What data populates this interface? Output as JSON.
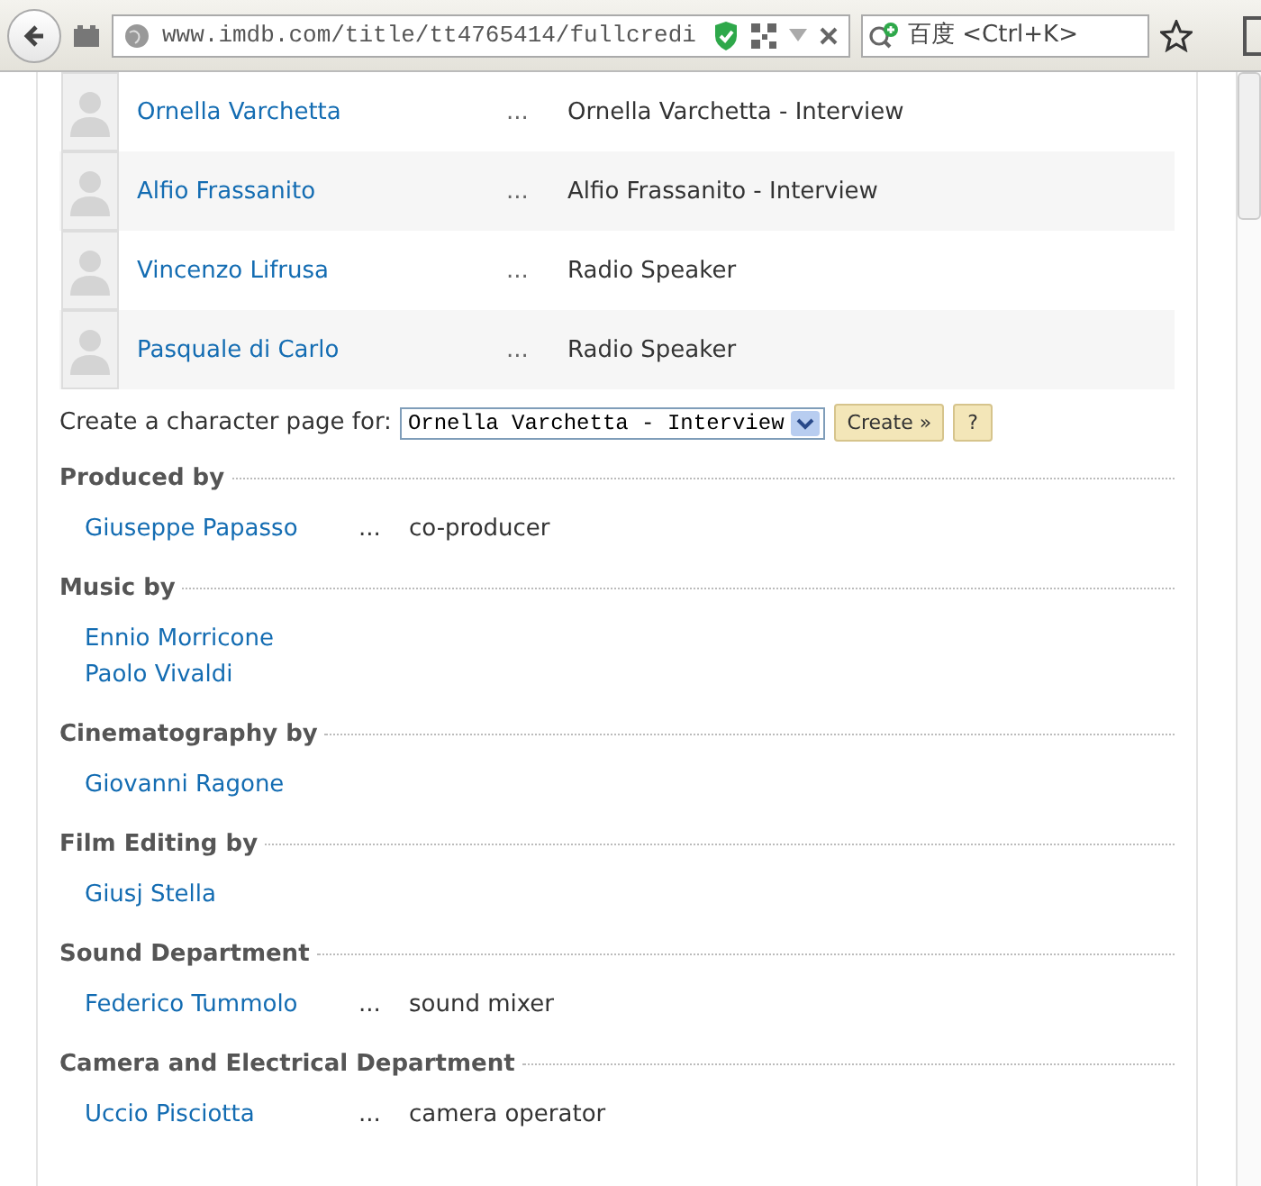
{
  "toolbar": {
    "url": "www.imdb.com/title/tt4765414/fullcredi",
    "search": {
      "placeholder": "百度 <Ctrl+K>"
    }
  },
  "cast": [
    {
      "name": "Ornella Varchetta",
      "dots": "...",
      "character": "Ornella Varchetta - Interview"
    },
    {
      "name": "Alfio Frassanito",
      "dots": "...",
      "character": "Alfio Frassanito - Interview"
    },
    {
      "name": "Vincenzo Lifrusa",
      "dots": "...",
      "character": "Radio Speaker"
    },
    {
      "name": "Pasquale di Carlo",
      "dots": "...",
      "character": "Radio Speaker"
    }
  ],
  "character_page": {
    "label": "Create a character page for:",
    "select_value": "Ornella Varchetta - Interview",
    "create_button": "Create »",
    "help_button": "?"
  },
  "sections": [
    {
      "title": "Produced by",
      "entries": [
        {
          "name": "Giuseppe Papasso",
          "dots": "...",
          "credit": "co-producer"
        }
      ]
    },
    {
      "title": "Music by",
      "entries": [
        {
          "name": "Ennio Morricone"
        },
        {
          "name": "Paolo Vivaldi"
        }
      ]
    },
    {
      "title": "Cinematography by",
      "entries": [
        {
          "name": "Giovanni Ragone"
        }
      ]
    },
    {
      "title": "Film Editing by",
      "entries": [
        {
          "name": "Giusj Stella"
        }
      ]
    },
    {
      "title": "Sound Department",
      "entries": [
        {
          "name": "Federico Tummolo",
          "dots": "...",
          "credit": "sound mixer"
        }
      ]
    },
    {
      "title": "Camera and Electrical Department",
      "entries": [
        {
          "name": "Uccio Pisciotta",
          "dots": "...",
          "credit": "camera operator"
        }
      ]
    }
  ]
}
